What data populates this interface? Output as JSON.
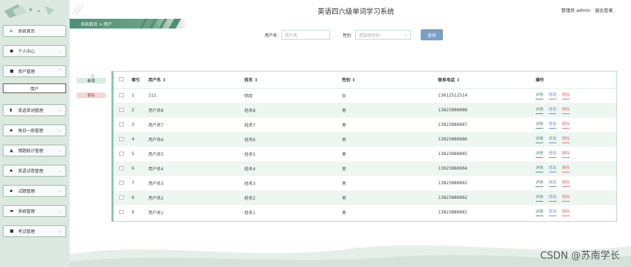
{
  "app": {
    "title": "英语四六级单词学习系统",
    "admin_role": "管理员 admin",
    "logout": "退出登录"
  },
  "breadcrumb": "系统首页 > 用户",
  "sidebar": {
    "items": [
      {
        "label": "系统首页",
        "icon": "home-icon"
      },
      {
        "label": "个人中心",
        "icon": "person-icon"
      },
      {
        "label": "用户管理",
        "icon": "folder-icon"
      },
      {
        "label": "英语单词管理",
        "icon": "chart-icon"
      },
      {
        "label": "每日一练管理",
        "icon": "grid-icon"
      },
      {
        "label": "错题统计管理",
        "icon": "stats-icon"
      },
      {
        "label": "英语试卷管理",
        "icon": "grid-icon"
      },
      {
        "label": "试题管理",
        "icon": "grid-icon"
      },
      {
        "label": "系统管理",
        "icon": "message-icon"
      },
      {
        "label": "考试管理",
        "icon": "exam-icon"
      }
    ],
    "submenu_active": "用户"
  },
  "search": {
    "username_label": "用户名",
    "username_placeholder": "用户名",
    "gender_label": "性别",
    "gender_placeholder": "请选择性别",
    "button": "查询"
  },
  "actions": {
    "add": "新增",
    "delete": "删除"
  },
  "table": {
    "headers": [
      "",
      "索引",
      "用户名 ⇕",
      "姓名 ⇕",
      "性别 ⇕",
      "联系电话 ⇕",
      "操作"
    ],
    "rows": [
      {
        "idx": "1",
        "username": "111",
        "name": "明月",
        "gender": "女",
        "phone": "13612512514"
      },
      {
        "idx": "2",
        "username": "用户名8",
        "name": "姓名8",
        "gender": "男",
        "phone": "13823888888"
      },
      {
        "idx": "3",
        "username": "用户名7",
        "name": "姓名7",
        "gender": "男",
        "phone": "13823888887"
      },
      {
        "idx": "4",
        "username": "用户名6",
        "name": "姓名6",
        "gender": "男",
        "phone": "13823888886"
      },
      {
        "idx": "5",
        "username": "用户名5",
        "name": "姓名5",
        "gender": "男",
        "phone": "13823888885"
      },
      {
        "idx": "6",
        "username": "用户名4",
        "name": "姓名4",
        "gender": "男",
        "phone": "13823888884"
      },
      {
        "idx": "7",
        "username": "用户名3",
        "name": "姓名3",
        "gender": "男",
        "phone": "13823888883"
      },
      {
        "idx": "8",
        "username": "用户名2",
        "name": "姓名2",
        "gender": "男",
        "phone": "13823888882"
      },
      {
        "idx": "9",
        "username": "用户名1",
        "name": "姓名1",
        "gender": "男",
        "phone": "13823888881"
      }
    ],
    "op_labels": {
      "detail": "详情",
      "edit": "修改",
      "delete": "删除"
    }
  },
  "watermark": "CSDN @苏南学长",
  "colors": {
    "sidebar_bg": "#dbe9e1",
    "accent_green": "#4f8f76",
    "search_button": "#7b9fc4",
    "delete_red": "#d07a78"
  }
}
